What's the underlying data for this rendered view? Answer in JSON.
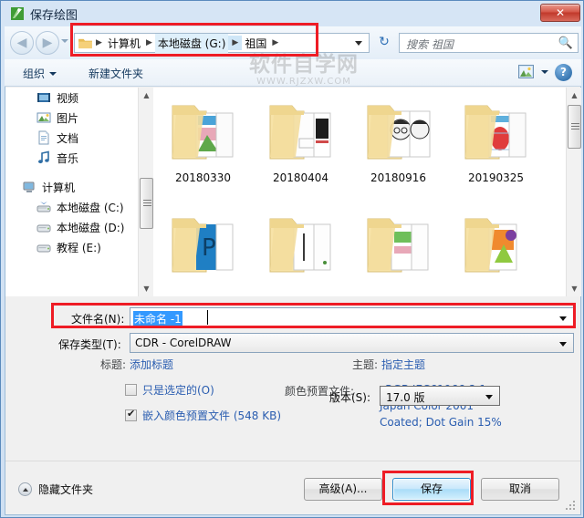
{
  "window": {
    "title": "保存绘图",
    "icon": "coreldraw-icon",
    "close_label": "✕"
  },
  "navbar": {
    "back_icon": "back-arrow-icon",
    "forward_icon": "forward-arrow-icon",
    "history_icon": "history-dropdown-icon",
    "folder_icon": "folder-icon",
    "breadcrumbs": [
      {
        "label": "计算机",
        "highlighted": false
      },
      {
        "label": "本地磁盘 (G:)",
        "highlighted": true
      },
      {
        "label": "祖国",
        "highlighted": false
      }
    ],
    "dropdown_icon": "chevron-down-icon",
    "refresh_icon": "refresh-icon",
    "refresh_glyph": "↻"
  },
  "search": {
    "placeholder": "搜索 祖国",
    "icon": "search-icon"
  },
  "toolbar": {
    "organize_label": "组织",
    "new_folder_label": "新建文件夹",
    "view_icon": "view-mode-icon",
    "help_icon": "help-icon",
    "help_glyph": "?"
  },
  "watermark": {
    "main": "软件自学网",
    "sub": "WWW.RJZXW.COM"
  },
  "sidebar": {
    "items": [
      {
        "label": "视频",
        "icon": "video-icon",
        "level": 1
      },
      {
        "label": "图片",
        "icon": "pictures-icon",
        "level": 1
      },
      {
        "label": "文档",
        "icon": "documents-icon",
        "level": 1
      },
      {
        "label": "音乐",
        "icon": "music-icon",
        "level": 1
      },
      {
        "label": "计算机",
        "icon": "computer-icon",
        "level": 0
      },
      {
        "label": "本地磁盘 (C:)",
        "icon": "system-drive-icon",
        "level": 1
      },
      {
        "label": "本地磁盘 (D:)",
        "icon": "drive-icon",
        "level": 1
      },
      {
        "label": "教程 (E:)",
        "icon": "drive-icon",
        "level": 1
      }
    ],
    "scroll_up_icon": "scroll-up-icon",
    "scroll_down_icon": "scroll-down-icon"
  },
  "files": {
    "items": [
      {
        "label": "20180330",
        "icon": "folder-thumbnail-icon"
      },
      {
        "label": "20180404",
        "icon": "folder-thumbnail-icon"
      },
      {
        "label": "20180916",
        "icon": "folder-thumbnail-icon"
      },
      {
        "label": "20190325",
        "icon": "folder-thumbnail-icon"
      },
      {
        "label": "",
        "icon": "folder-thumbnail-icon"
      },
      {
        "label": "",
        "icon": "folder-thumbnail-icon"
      },
      {
        "label": "",
        "icon": "folder-thumbnail-icon"
      },
      {
        "label": "",
        "icon": "folder-thumbnail-icon"
      }
    ],
    "scroll_up_icon": "scroll-up-icon",
    "scroll_down_icon": "scroll-down-icon"
  },
  "form": {
    "filename_label": "文件名(N):",
    "filename_value": "未命名 -1",
    "filetype_label": "保存类型(T):",
    "filetype_value": "CDR - CorelDRAW",
    "title_label": "标题:",
    "title_value": "添加标题",
    "subject_label": "主题:",
    "subject_value": "指定主题",
    "selected_only_label": "只是选定的(O)",
    "selected_only_checked": false,
    "embed_profile_label": "嵌入颜色预置文件 (548 KB)",
    "embed_profile_checked": true,
    "color_profile_label": "颜色预置文件:",
    "color_profile_lines": [
      "sRGB IEC61966-2.1;",
      "Japan Color 2001",
      "Coated; Dot Gain 15%"
    ],
    "version_label": "版本(S):",
    "version_value": "17.0 版"
  },
  "footer": {
    "hide_folders_label": "隐藏文件夹",
    "hide_folders_icon": "collapse-arrow-icon",
    "advanced_label": "高级(A)...",
    "save_label": "保存",
    "cancel_label": "取消"
  },
  "colors": {
    "annotation_red": "#ee1c25",
    "link_blue": "#2a5db0",
    "selection_blue": "#3399ff",
    "save_button_border": "#2c8ccc"
  }
}
